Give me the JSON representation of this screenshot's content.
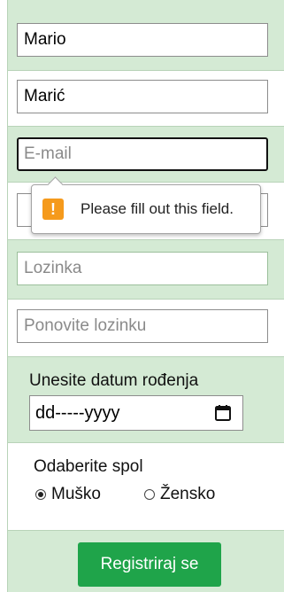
{
  "form": {
    "first_name_value": "Mario",
    "last_name_value": "Marić",
    "email_placeholder": "E-mail",
    "password_placeholder": "Lozinka",
    "repeat_password_placeholder": "Ponovite lozinku",
    "birthdate_label": "Unesite datum rođenja",
    "birthdate_placeholder": "dd-----yyyy",
    "gender_label": "Odaberite spol",
    "gender_options": [
      {
        "label": "Muško",
        "checked": true
      },
      {
        "label": "Žensko",
        "checked": false
      }
    ],
    "submit_label": "Registriraj se"
  },
  "validation": {
    "message": "Please fill out this field.",
    "icon": "warning-icon",
    "icon_glyph": "!"
  },
  "colors": {
    "row_green": "#d4ead4",
    "submit_green": "#1fa44a",
    "warning_orange": "#f59a1c"
  }
}
